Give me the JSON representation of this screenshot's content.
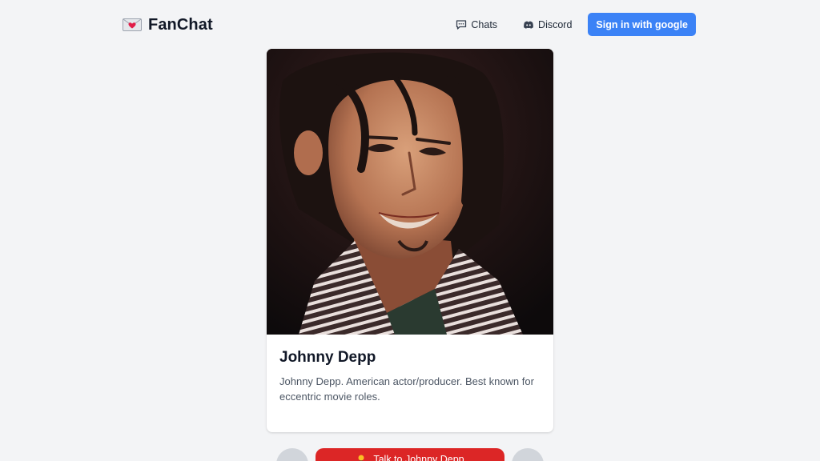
{
  "header": {
    "brand_name": "FanChat",
    "brand_icon": "love-letter-icon",
    "nav": {
      "chats_label": "Chats",
      "discord_label": "Discord",
      "signin_label": "Sign in with google"
    }
  },
  "card": {
    "name": "Johnny Depp",
    "description": "Johnny Depp. American actor/producer. Best known for eccentric movie roles."
  },
  "controls": {
    "prev_symbol": "←",
    "next_symbol": "→",
    "talk_label": "Talk to Johnny Depp"
  },
  "colors": {
    "accent": "#3b82f6",
    "talk": "#dc2626",
    "background": "#f3f4f6"
  }
}
